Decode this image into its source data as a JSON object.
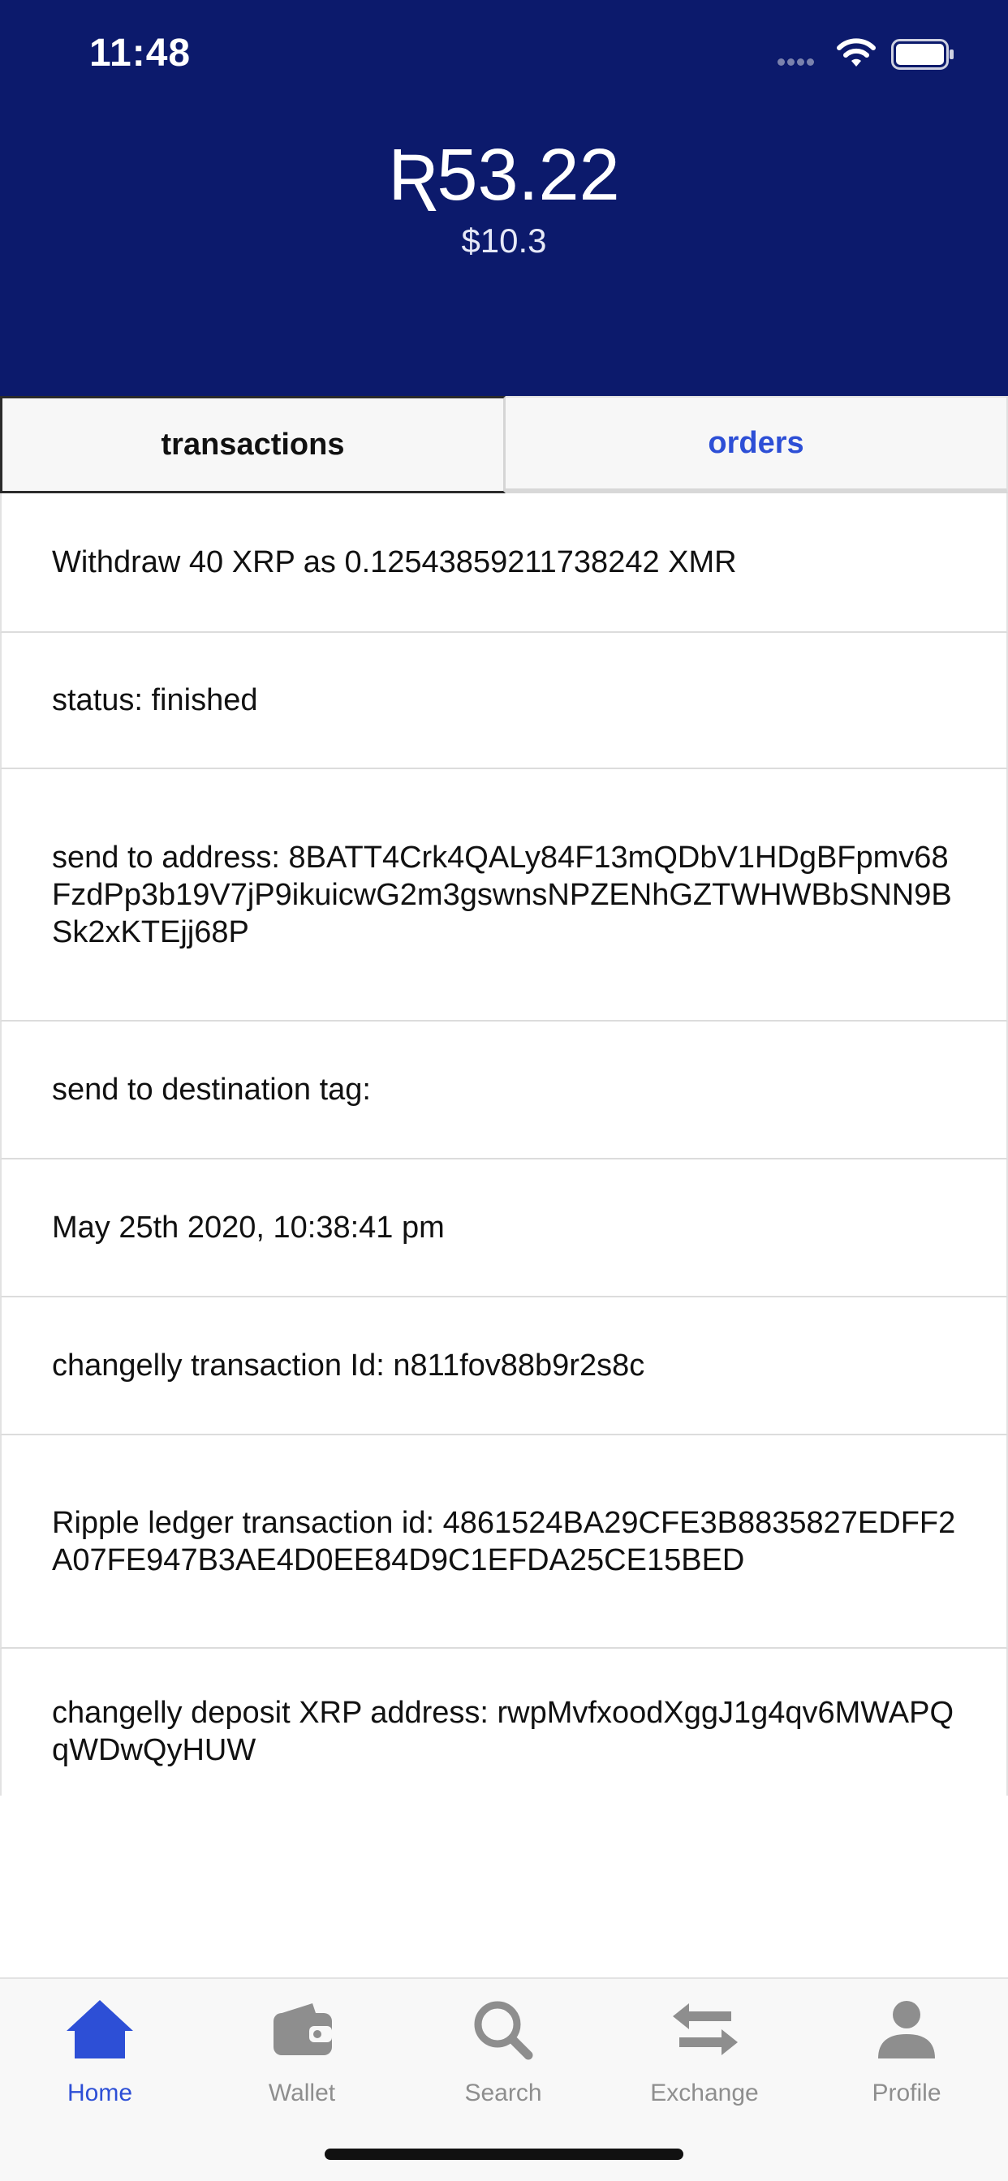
{
  "status_bar": {
    "time": "11:48"
  },
  "header": {
    "balance": "Ʀ53.22",
    "balance_usd": "$10.3"
  },
  "tabs": [
    {
      "label": "transactions",
      "active": true
    },
    {
      "label": "orders",
      "active": false
    }
  ],
  "details": [
    "Withdraw 40 XRP as 0.12543859211738242 XMR",
    "status:  finished",
    "send to address: 8BATT4Crk4QALy84F13mQDbV1HDgBFpmv68FzdPp3b19V7jP9ikuicwG2m3gswnsNPZENhGZTWHWBbSNN9BSk2xKTEjj68P",
    "send to destination tag:",
    "May 25th 2020, 10:38:41 pm",
    "changelly transaction Id:  n811fov88b9r2s8c",
    "Ripple ledger transaction id: 4861524BA29CFE3B8835827EDFF2A07FE947B3AE4D0EE84D9C1EFDA25CE15BED",
    "changelly deposit XRP address: rwpMvfxoodXggJ1g4qv6MWAPQqWDwQyHUW"
  ],
  "nav": {
    "home": "Home",
    "wallet": "Wallet",
    "search": "Search",
    "exchange": "Exchange",
    "profile": "Profile"
  },
  "colors": {
    "header_bg": "#0c1a6c",
    "accent": "#2d4fd6",
    "inactive": "#8e8e8e"
  }
}
